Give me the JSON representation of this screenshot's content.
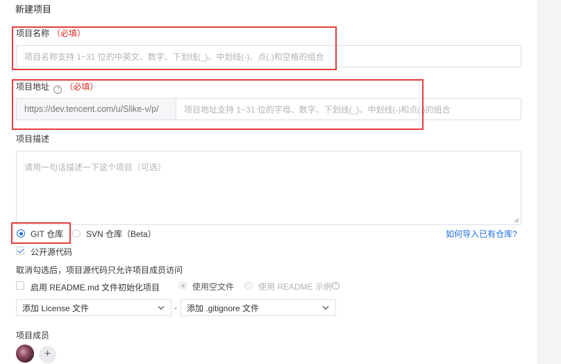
{
  "page_title": "新建项目",
  "project_name": {
    "label": "项目名称",
    "required": "（必填）",
    "placeholder": "项目名称支持 1~31 位的中英文、数字、下划线(_)、中划线(-)、点(.)和空格的组合"
  },
  "project_address": {
    "label": "项目地址",
    "help_icon": "question-circle-icon",
    "required": "（必填）",
    "prefix": "https://dev.tencent.com/u/Slike-v/p/",
    "placeholder": "项目地址支持 1~31 位的字母、数字、下划线(_)、中划线(-)和点(.)的组合"
  },
  "project_description": {
    "label": "项目描述",
    "placeholder": "请用一句话描述一下这个项目（可选）"
  },
  "repo_type": {
    "options": [
      {
        "label": "GIT 仓库",
        "selected": true
      },
      {
        "label": "SVN 仓库（Beta）",
        "selected": false
      }
    ],
    "import_link": "如何导入已有仓库?"
  },
  "public_source": {
    "label": "公开源代码",
    "checked": true,
    "hint": "取消勾选后，项目源代码只允许项目成员访问"
  },
  "readme": {
    "label": "启用 README.md 文件初始化项目",
    "checked": false,
    "options": [
      {
        "label": "使用空文件",
        "selected": true
      },
      {
        "label": "使用 README 示例",
        "selected": false
      }
    ],
    "help_icon": "question-circle-icon"
  },
  "license_select": {
    "value": "添加 License 文件"
  },
  "separator": "-",
  "gitignore_select": {
    "value": "添加 .gitignore 文件"
  },
  "members": {
    "label": "项目成员",
    "add_label": "+"
  },
  "colors": {
    "accent": "#1e6fe0",
    "required": "#e0281e",
    "highlight_box": "#e23b3b"
  }
}
